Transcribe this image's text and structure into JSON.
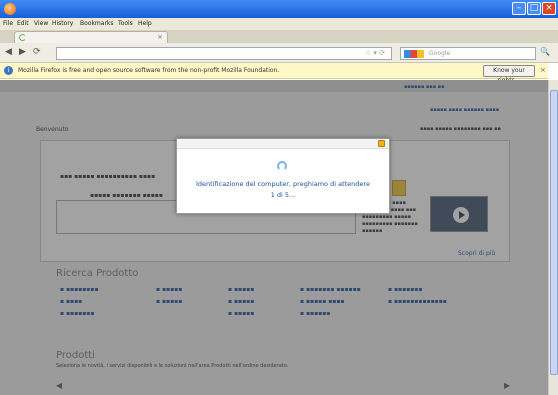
{
  "window": {
    "title": "",
    "controls": [
      "minimize",
      "maximize",
      "close"
    ]
  },
  "menubar": {
    "items": [
      "File",
      "Edit",
      "View",
      "History",
      "Bookmarks",
      "Tools",
      "Help"
    ]
  },
  "tab": {
    "title": "",
    "close_glyph": "×"
  },
  "navigation": {
    "back_glyph": "◀",
    "forward_glyph": "▶",
    "reload_glyph": "⟳",
    "url": "",
    "url_right": "☆ ▾ ⟳",
    "search_placeholder": "Google",
    "search_glyph": "🔍"
  },
  "notification": {
    "text": "Mozilla Firefox is free and open source software from the non-profit Mozilla Foundation.",
    "button": "Know your rights...",
    "close_glyph": "×"
  },
  "modal": {
    "message": "Identificazione del computer, preghiamo di attendere",
    "step": "1 di 5..."
  },
  "colors": {
    "titlebar": "#2a6fe6",
    "modal_text": "#1b4f9c",
    "lock": "#f0b01c"
  },
  "background_page": {
    "welcome": "Benvenuto",
    "search_section": "Ricerca Prodotto",
    "products_title": "Prodotti",
    "products_desc": "Seleziona le novità, i servizi disponibili e le soluzioni nell'area Prodotti nell'ordine desiderato.",
    "scopri": "Scopri di più"
  }
}
